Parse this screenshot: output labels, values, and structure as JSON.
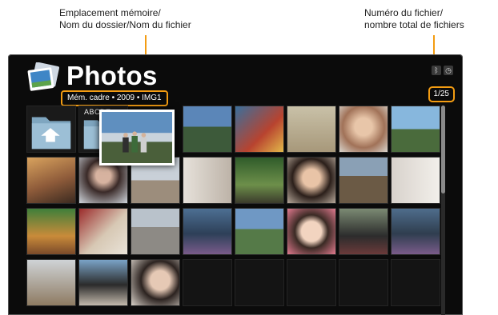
{
  "callouts": {
    "left": [
      "Emplacement mémoire/",
      "Nom du dossier/Nom du fichier"
    ],
    "right": [
      "Numéro du fichier/",
      "nombre total de fichiers"
    ]
  },
  "app": {
    "title": "Photos",
    "icon": "photos-icon"
  },
  "path_text": "Mém. cadre • 2009 • IMG1",
  "counter": "1/25",
  "status_icons": [
    "bluetooth-icon",
    "clock-icon"
  ],
  "grid": {
    "folder_label": "ABCDE",
    "colors": {
      "accent": "#f39c12",
      "folder": "#7fa6c0",
      "frame_bg": "#0b0b0b"
    }
  }
}
